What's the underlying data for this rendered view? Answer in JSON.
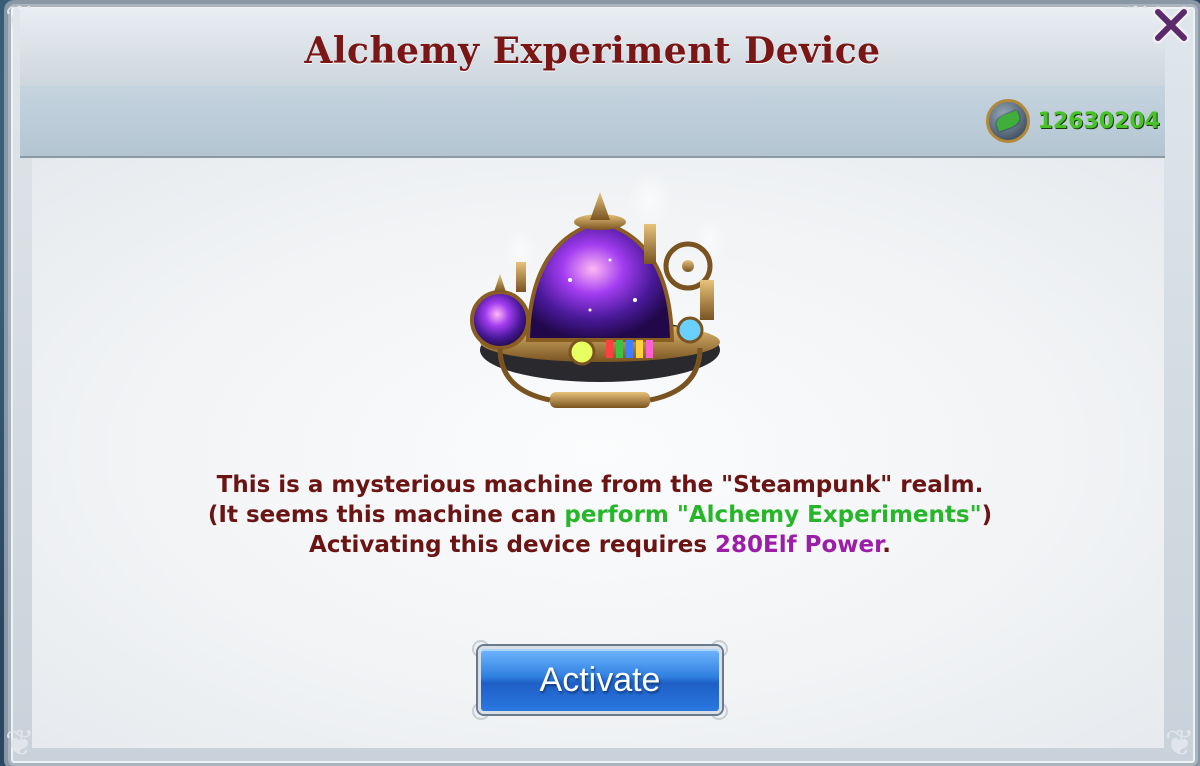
{
  "window": {
    "title": "Alchemy Experiment Device"
  },
  "currency": {
    "icon": "elf-leaf-coin-icon",
    "value": "12630204"
  },
  "description": {
    "line1": "This is a mysterious machine from the \"Steampunk\" realm.",
    "line2_prefix": "(It seems this machine can ",
    "line2_highlight": "perform \"Alchemy Experiments\"",
    "line2_suffix": ")",
    "line3_prefix": "Activating this device requires ",
    "line3_amount": "280",
    "line3_unit": "Elf Power",
    "line3_suffix": "."
  },
  "actions": {
    "activate_label": "Activate"
  },
  "colors": {
    "title": "#7a1616",
    "text": "#6b1414",
    "highlight_green": "#27b52a",
    "highlight_purple": "#9b1ea8",
    "button_blue": "#2f7fe0",
    "currency_green": "#49c22a"
  }
}
